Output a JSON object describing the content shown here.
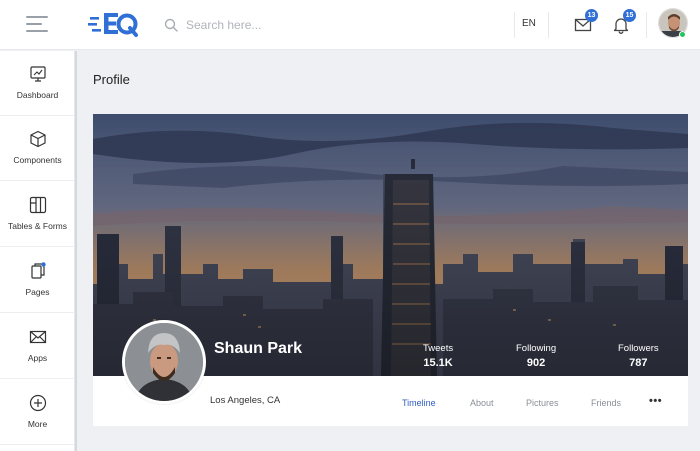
{
  "app": {
    "logo_text": "EQ"
  },
  "header": {
    "search_placeholder": "Search here...",
    "language": "EN",
    "mail_badge": "13",
    "notifications_badge": "15"
  },
  "sidebar": {
    "items": [
      {
        "label": "Dashboard",
        "icon": "dashboard-icon"
      },
      {
        "label": "Components",
        "icon": "cube-icon"
      },
      {
        "label": "Tables & Forms",
        "icon": "table-icon"
      },
      {
        "label": "Pages",
        "icon": "pages-icon"
      },
      {
        "label": "Apps",
        "icon": "mail-icon"
      },
      {
        "label": "More",
        "icon": "plus-circle-icon"
      }
    ]
  },
  "page": {
    "title": "Profile"
  },
  "profile": {
    "name": "Shaun Park",
    "location": "Los Angeles, CA",
    "stats": [
      {
        "label": "Tweets",
        "value": "15.1K"
      },
      {
        "label": "Following",
        "value": "902"
      },
      {
        "label": "Followers",
        "value": "787"
      }
    ],
    "tabs": [
      {
        "label": "Timeline",
        "active": true
      },
      {
        "label": "About",
        "active": false
      },
      {
        "label": "Pictures",
        "active": false
      },
      {
        "label": "Friends",
        "active": false
      }
    ],
    "more_label": "•••"
  },
  "colors": {
    "accent": "#2f6fd6",
    "active_tab": "#2f5fbf",
    "online": "#22c55e"
  }
}
